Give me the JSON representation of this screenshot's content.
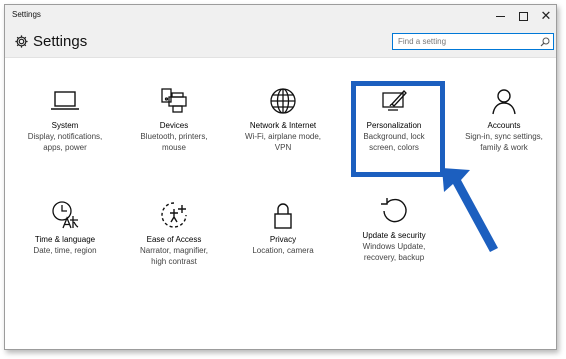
{
  "window": {
    "title": "Settings",
    "controls": {
      "minimize": "",
      "maximize": "",
      "close": "✕"
    }
  },
  "header": {
    "title": "Settings",
    "search_placeholder": "Find a setting"
  },
  "tiles": [
    {
      "name": "System",
      "desc": "Display, notifications,\napps, power",
      "icon": "laptop-icon"
    },
    {
      "name": "Devices",
      "desc": "Bluetooth, printers,\nmouse",
      "icon": "devices-icon"
    },
    {
      "name": "Network & Internet",
      "desc": "Wi-Fi, airplane mode,\nVPN",
      "icon": "globe-icon"
    },
    {
      "name": "Personalization",
      "desc": "Background, lock\nscreen, colors",
      "icon": "personalization-icon"
    },
    {
      "name": "Accounts",
      "desc": "Sign-in, sync settings,\nfamily & work",
      "icon": "person-icon"
    },
    {
      "name": "Time & language",
      "desc": "Date, time, region",
      "icon": "clock-language-icon"
    },
    {
      "name": "Ease of Access",
      "desc": "Narrator, magnifier,\nhigh contrast",
      "icon": "ease-of-access-icon"
    },
    {
      "name": "Privacy",
      "desc": "Location, camera",
      "icon": "lock-icon"
    },
    {
      "name": "Update & security",
      "desc": "Windows Update,\nrecovery, backup",
      "icon": "refresh-icon"
    }
  ],
  "annotation": {
    "highlight_color": "#1c5fbf",
    "target": "Personalization"
  }
}
